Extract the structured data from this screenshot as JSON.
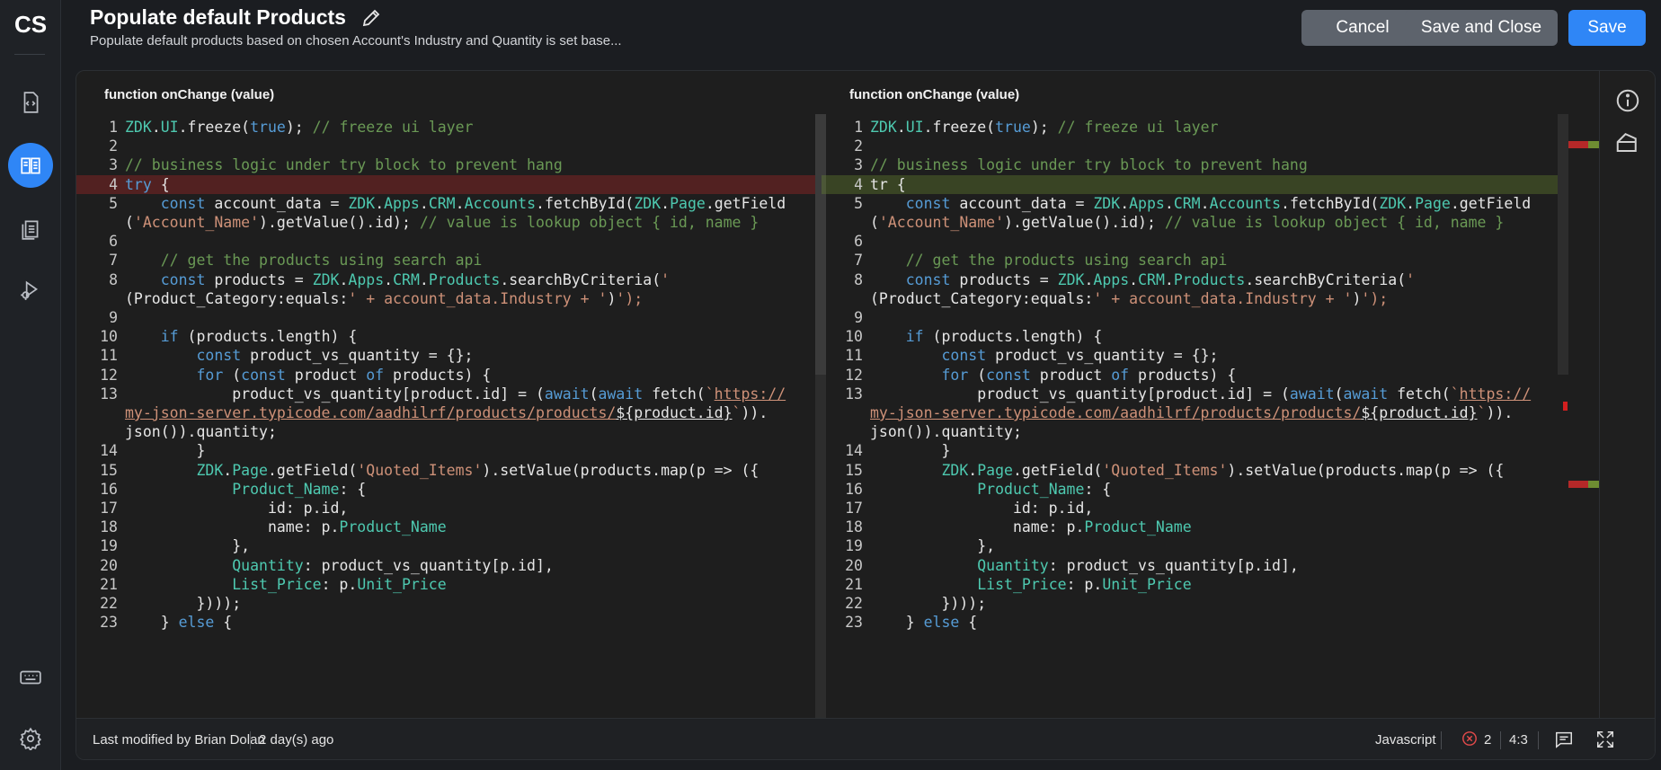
{
  "app": {
    "logo": "CS"
  },
  "header": {
    "title": "Populate default Products",
    "subtitle": "Populate default products based on chosen Account's Industry and Quantity is set base...",
    "cancel_label": "Cancel",
    "save_close_label": "Save and Close",
    "save_label": "Save"
  },
  "rail": {
    "items": [
      {
        "icon": "code-file-icon",
        "active": false
      },
      {
        "icon": "book-icon",
        "active": true
      },
      {
        "icon": "documents-icon",
        "active": false
      },
      {
        "icon": "bug-run-icon",
        "active": false
      },
      {
        "icon": "keyboard-icon",
        "active": false
      },
      {
        "icon": "gear-icon",
        "active": false
      }
    ]
  },
  "editor": {
    "left_header": "function onChange (value)",
    "right_header": "function onChange (value)",
    "removed_line": 4,
    "added_line": 4,
    "colors": {
      "accent": "#2f86f6",
      "removed": "#b42828",
      "added": "#6e8c32",
      "keyword": "#569cd6",
      "namespace": "#4ec9b0",
      "string": "#ce9178",
      "comment": "#6a9955"
    }
  },
  "code_left": [
    {
      "n": "1",
      "t": "ZDK.UI.freeze(true); // freeze ui layer"
    },
    {
      "n": "2",
      "t": ""
    },
    {
      "n": "3",
      "t": "// business logic under try block to prevent hang"
    },
    {
      "n": "4",
      "t": "try {"
    },
    {
      "n": "5",
      "t": "    const account_data = ZDK.Apps.CRM.Accounts.fetchById(ZDK.Page.getField"
    },
    {
      "n": "",
      "t": "('Account_Name').getValue().id); // value is lookup object { id, name }"
    },
    {
      "n": "6",
      "t": ""
    },
    {
      "n": "7",
      "t": "    // get the products using search api"
    },
    {
      "n": "8",
      "t": "    const products = ZDK.Apps.CRM.Products.searchByCriteria('"
    },
    {
      "n": "",
      "t": "(Product_Category:equals:' + account_data.Industry + ')');"
    },
    {
      "n": "9",
      "t": ""
    },
    {
      "n": "10",
      "t": "    if (products.length) {"
    },
    {
      "n": "11",
      "t": "        const product_vs_quantity = {};"
    },
    {
      "n": "12",
      "t": "        for (const product of products) {"
    },
    {
      "n": "13",
      "t": "            product_vs_quantity[product.id] = (await(await fetch(`https://"
    },
    {
      "n": "",
      "t": "my-json-server.typicode.com/aadhilrf/products/products/${product.id}`))."
    },
    {
      "n": "",
      "t": "json()).quantity;"
    },
    {
      "n": "14",
      "t": "        }"
    },
    {
      "n": "15",
      "t": "        ZDK.Page.getField('Quoted_Items').setValue(products.map(p => ({"
    },
    {
      "n": "16",
      "t": "            Product_Name: {"
    },
    {
      "n": "17",
      "t": "                id: p.id,"
    },
    {
      "n": "18",
      "t": "                name: p.Product_Name"
    },
    {
      "n": "19",
      "t": "            },"
    },
    {
      "n": "20",
      "t": "            Quantity: product_vs_quantity[p.id],"
    },
    {
      "n": "21",
      "t": "            List_Price: p.Unit_Price"
    },
    {
      "n": "22",
      "t": "        })));"
    },
    {
      "n": "23",
      "t": "    } else {"
    }
  ],
  "code_right": [
    {
      "n": "1",
      "t": "ZDK.UI.freeze(true); // freeze ui layer"
    },
    {
      "n": "2",
      "t": ""
    },
    {
      "n": "3",
      "t": "// business logic under try block to prevent hang"
    },
    {
      "n": "4",
      "t": "tr {"
    },
    {
      "n": "5",
      "t": "    const account_data = ZDK.Apps.CRM.Accounts.fetchById(ZDK.Page.getField"
    },
    {
      "n": "",
      "t": "('Account_Name').getValue().id); // value is lookup object { id, name }"
    },
    {
      "n": "6",
      "t": ""
    },
    {
      "n": "7",
      "t": "    // get the products using search api"
    },
    {
      "n": "8",
      "t": "    const products = ZDK.Apps.CRM.Products.searchByCriteria('"
    },
    {
      "n": "",
      "t": "(Product_Category:equals:' + account_data.Industry + ')');"
    },
    {
      "n": "9",
      "t": ""
    },
    {
      "n": "10",
      "t": "    if (products.length) {"
    },
    {
      "n": "11",
      "t": "        const product_vs_quantity = {};"
    },
    {
      "n": "12",
      "t": "        for (const product of products) {"
    },
    {
      "n": "13",
      "t": "            product_vs_quantity[product.id] = (await(await fetch(`https://"
    },
    {
      "n": "",
      "t": "my-json-server.typicode.com/aadhilrf/products/products/${product.id}`))."
    },
    {
      "n": "",
      "t": "json()).quantity;"
    },
    {
      "n": "14",
      "t": "        }"
    },
    {
      "n": "15",
      "t": "        ZDK.Page.getField('Quoted_Items').setValue(products.map(p => ({"
    },
    {
      "n": "16",
      "t": "            Product_Name: {"
    },
    {
      "n": "17",
      "t": "                id: p.id,"
    },
    {
      "n": "18",
      "t": "                name: p.Product_Name"
    },
    {
      "n": "19",
      "t": "            },"
    },
    {
      "n": "20",
      "t": "            Quantity: product_vs_quantity[p.id],"
    },
    {
      "n": "21",
      "t": "            List_Price: p.Unit_Price"
    },
    {
      "n": "22",
      "t": "        })));"
    },
    {
      "n": "23",
      "t": "    } else {"
    }
  ],
  "status": {
    "last_modified_label": "Last modified by Brian Dolan",
    "modified_ago": "2 day(s) ago",
    "language": "Javascript",
    "error_count": "2",
    "cursor": "4:3"
  }
}
